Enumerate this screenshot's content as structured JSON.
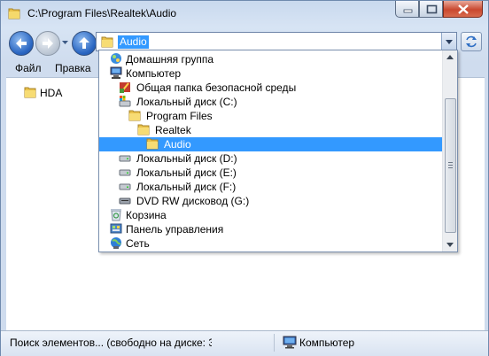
{
  "window": {
    "title": "C:\\Program Files\\Realtek\\Audio",
    "caption_buttons": [
      "minimize",
      "maximize",
      "close"
    ]
  },
  "address_bar": {
    "value": "Audio",
    "icon": "folder-icon"
  },
  "menu": {
    "items": [
      {
        "label": "Файл"
      },
      {
        "label": "Правка"
      }
    ]
  },
  "content": {
    "items": [
      {
        "label": "HDA",
        "icon": "folder-icon"
      }
    ]
  },
  "dropdown": {
    "items": [
      {
        "label": "Домашняя группа",
        "icon": "homegroup-icon",
        "level": 0
      },
      {
        "label": "Компьютер",
        "icon": "computer-icon",
        "level": 0
      },
      {
        "label": "Общая папка безопасной среды",
        "icon": "sandbox-folder-icon",
        "level": 1
      },
      {
        "label": "Локальный диск (C:)",
        "icon": "system-drive-icon",
        "level": 1
      },
      {
        "label": "Program Files",
        "icon": "folder-icon",
        "level": 2
      },
      {
        "label": "Realtek",
        "icon": "folder-icon",
        "level": 3
      },
      {
        "label": "Audio",
        "icon": "folder-icon",
        "level": 4,
        "selected": true
      },
      {
        "label": "Локальный диск (D:)",
        "icon": "drive-icon",
        "level": 1
      },
      {
        "label": "Локальный диск (E:)",
        "icon": "drive-icon",
        "level": 1
      },
      {
        "label": "Локальный диск (F:)",
        "icon": "drive-icon",
        "level": 1
      },
      {
        "label": "DVD RW дисковод (G:)",
        "icon": "dvd-drive-icon",
        "level": 1
      },
      {
        "label": "Корзина",
        "icon": "recycle-bin-icon",
        "level": 0
      },
      {
        "label": "Панель управления",
        "icon": "control-panel-icon",
        "level": 0
      },
      {
        "label": "Сеть",
        "icon": "network-icon",
        "level": 0
      }
    ]
  },
  "status_bar": {
    "left_text": "Поиск элементов... (свободно на диске: 3",
    "right_text": "Компьютер",
    "right_icon": "computer-icon"
  },
  "colors": {
    "selection": "#3399ff",
    "chrome": "#cfdcee"
  }
}
